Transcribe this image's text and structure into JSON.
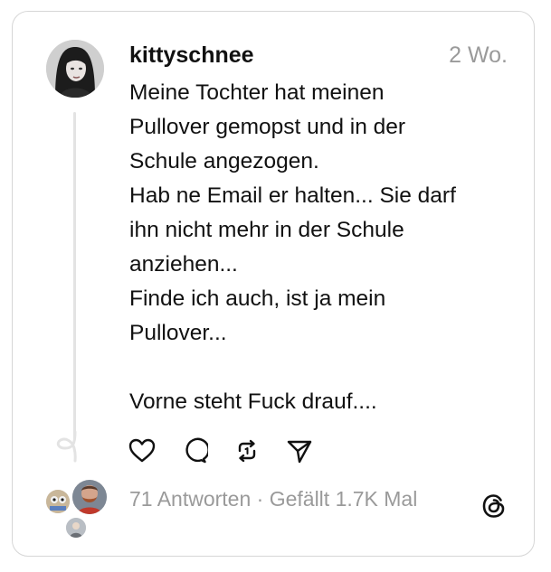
{
  "post": {
    "username": "kittyschnee",
    "time": "2 Wo.",
    "text": "Meine Tochter hat meinen\nPullover gemopst und in der\nSchule angezogen.\nHab ne Email er halten... Sie darf\nihn nicht mehr in der Schule\nanziehen...\nFinde ich auch, ist ja mein\nPullover...\n\nVorne steht Fuck drauf....",
    "stats": "71 Antworten · Gefällt 1.7K Mal"
  },
  "icons": {
    "like": "heart-icon",
    "reply": "comment-icon",
    "repost": "repost-icon",
    "share": "send-icon",
    "brand": "threads-logo"
  }
}
